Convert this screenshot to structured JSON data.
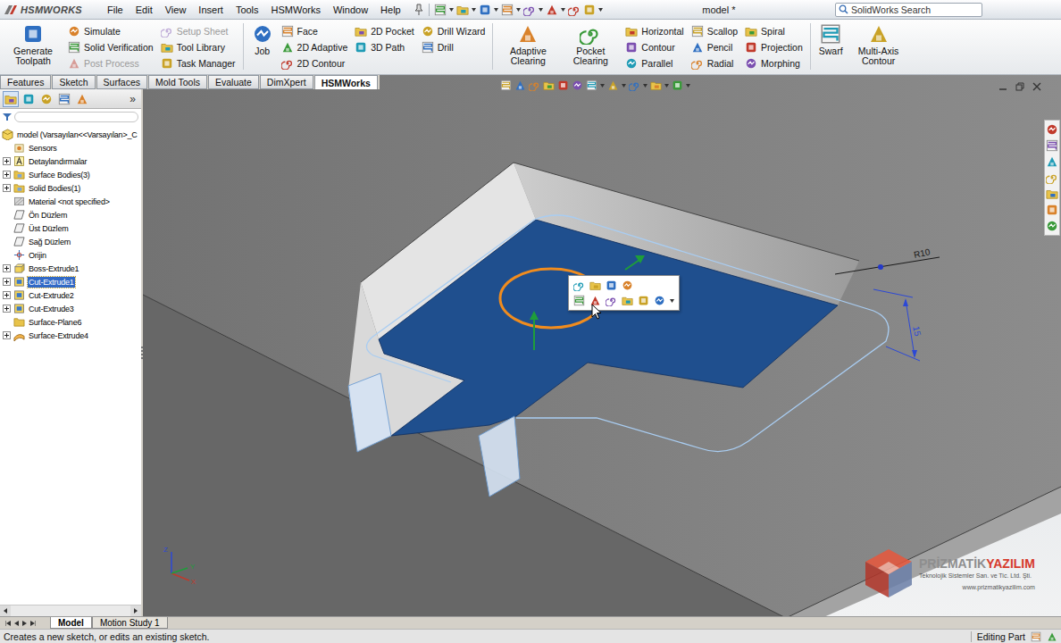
{
  "app": {
    "logo": "HSMWORKS",
    "title": "model *"
  },
  "menu": [
    "File",
    "Edit",
    "View",
    "Insert",
    "Tools",
    "HSMWorks",
    "Window",
    "Help"
  ],
  "search": {
    "placeholder": "SolidWorks Search"
  },
  "ribbon": [
    {
      "kind": "big",
      "label": "Generate Toolpath"
    },
    {
      "kind": "stack",
      "items": [
        {
          "label": "Simulate",
          "disabled": false
        },
        {
          "label": "Solid Verification",
          "disabled": false
        },
        {
          "label": "Post Process",
          "disabled": true
        }
      ]
    },
    {
      "kind": "stack",
      "items": [
        {
          "label": "Setup Sheet",
          "disabled": true
        },
        {
          "label": "Tool Library",
          "disabled": false
        },
        {
          "label": "Task Manager",
          "disabled": false
        }
      ]
    },
    {
      "kind": "separator"
    },
    {
      "kind": "big",
      "label": "Job"
    },
    {
      "kind": "stack",
      "items": [
        {
          "label": "Face",
          "disabled": false
        },
        {
          "label": "2D Adaptive",
          "disabled": false
        },
        {
          "label": "2D Contour",
          "disabled": false
        }
      ]
    },
    {
      "kind": "stack",
      "items": [
        {
          "label": "2D Pocket",
          "disabled": false
        },
        {
          "label": "3D Path",
          "disabled": false
        }
      ]
    },
    {
      "kind": "stack",
      "items": [
        {
          "label": "Drill Wizard",
          "disabled": false
        },
        {
          "label": "Drill",
          "disabled": false
        }
      ]
    },
    {
      "kind": "separator"
    },
    {
      "kind": "big",
      "label": "Adaptive Clearing"
    },
    {
      "kind": "big",
      "label": "Pocket Clearing"
    },
    {
      "kind": "stack",
      "items": [
        {
          "label": "Horizontal",
          "disabled": false
        },
        {
          "label": "Contour",
          "disabled": false
        },
        {
          "label": "Parallel",
          "disabled": false
        }
      ]
    },
    {
      "kind": "stack",
      "items": [
        {
          "label": "Scallop",
          "disabled": false
        },
        {
          "label": "Pencil",
          "disabled": false
        },
        {
          "label": "Radial",
          "disabled": false
        }
      ]
    },
    {
      "kind": "stack",
      "items": [
        {
          "label": "Spiral",
          "disabled": false
        },
        {
          "label": "Projection",
          "disabled": false
        },
        {
          "label": "Morphing",
          "disabled": false
        }
      ]
    },
    {
      "kind": "separator"
    },
    {
      "kind": "big",
      "label": "Swarf"
    },
    {
      "kind": "big",
      "label": "Multi-Axis Contour"
    }
  ],
  "tabs": [
    {
      "label": "Features",
      "selected": false
    },
    {
      "label": "Sketch",
      "selected": false
    },
    {
      "label": "Surfaces",
      "selected": false
    },
    {
      "label": "Mold Tools",
      "selected": false
    },
    {
      "label": "Evaluate",
      "selected": false
    },
    {
      "label": "DimXpert",
      "selected": false
    },
    {
      "label": "HSMWorks",
      "selected": true
    }
  ],
  "panel": {
    "tabs": [
      {
        "selected": true
      },
      {
        "selected": false
      },
      {
        "selected": false
      },
      {
        "selected": false
      },
      {
        "selected": false
      }
    ],
    "more": "»"
  },
  "tree": {
    "root": {
      "label": "model (Varsayılan<<Varsayılan>_C",
      "kind": "part"
    },
    "items": [
      {
        "label": "Sensors",
        "kind": "sensor",
        "expandable": false,
        "selected": false
      },
      {
        "label": "Detaylandırmalar",
        "kind": "annotation",
        "expandable": true,
        "selected": false
      },
      {
        "label": "Surface Bodies(3)",
        "kind": "bodies",
        "expandable": true,
        "selected": false
      },
      {
        "label": "Solid Bodies(1)",
        "kind": "bodies",
        "expandable": true,
        "selected": false
      },
      {
        "label": "Material <not specified>",
        "kind": "material",
        "expandable": false,
        "selected": false
      },
      {
        "label": "Ön Düzlem",
        "kind": "plane",
        "expandable": false,
        "selected": false
      },
      {
        "label": "Üst Düzlem",
        "kind": "plane",
        "expandable": false,
        "selected": false
      },
      {
        "label": "Sağ Düzlem",
        "kind": "plane",
        "expandable": false,
        "selected": false
      },
      {
        "label": "Orijin",
        "kind": "origin",
        "expandable": false,
        "selected": false
      },
      {
        "label": "Boss-Extrude1",
        "kind": "extrude",
        "expandable": true,
        "selected": false
      },
      {
        "label": "Cut-Extrude1",
        "kind": "cut",
        "expandable": true,
        "selected": true
      },
      {
        "label": "Cut-Extrude2",
        "kind": "cut",
        "expandable": true,
        "selected": false
      },
      {
        "label": "Cut-Extrude3",
        "kind": "cut",
        "expandable": true,
        "selected": false
      },
      {
        "label": "Surface-Plane6",
        "kind": "folder",
        "expandable": false,
        "selected": false
      },
      {
        "label": "Surface-Extrude4",
        "kind": "surface",
        "expandable": true,
        "selected": false
      }
    ]
  },
  "model": {
    "floor_selected": true,
    "edge_selected": true
  },
  "dimensions": [
    {
      "label": "R10",
      "color": "#1a1a1a"
    },
    {
      "label": "15",
      "color": "#2c48d6"
    }
  ],
  "triad": {
    "x": "X",
    "y": "Y",
    "z": "Z"
  },
  "watermark": {
    "brand_a": "PRİZMATİK",
    "brand_b": "YAZILIM",
    "subtitle": "Teknolojik Sistemler San. ve Tic. Ltd. Şti.",
    "url": "www.prizmatikyazilim.com"
  },
  "bottom_tabs": [
    {
      "label": "Model",
      "selected": true
    },
    {
      "label": "Motion Study 1",
      "selected": false
    }
  ],
  "status": {
    "message": "Creates a new sketch, or edits an existing sketch.",
    "mode": "Editing Part"
  }
}
